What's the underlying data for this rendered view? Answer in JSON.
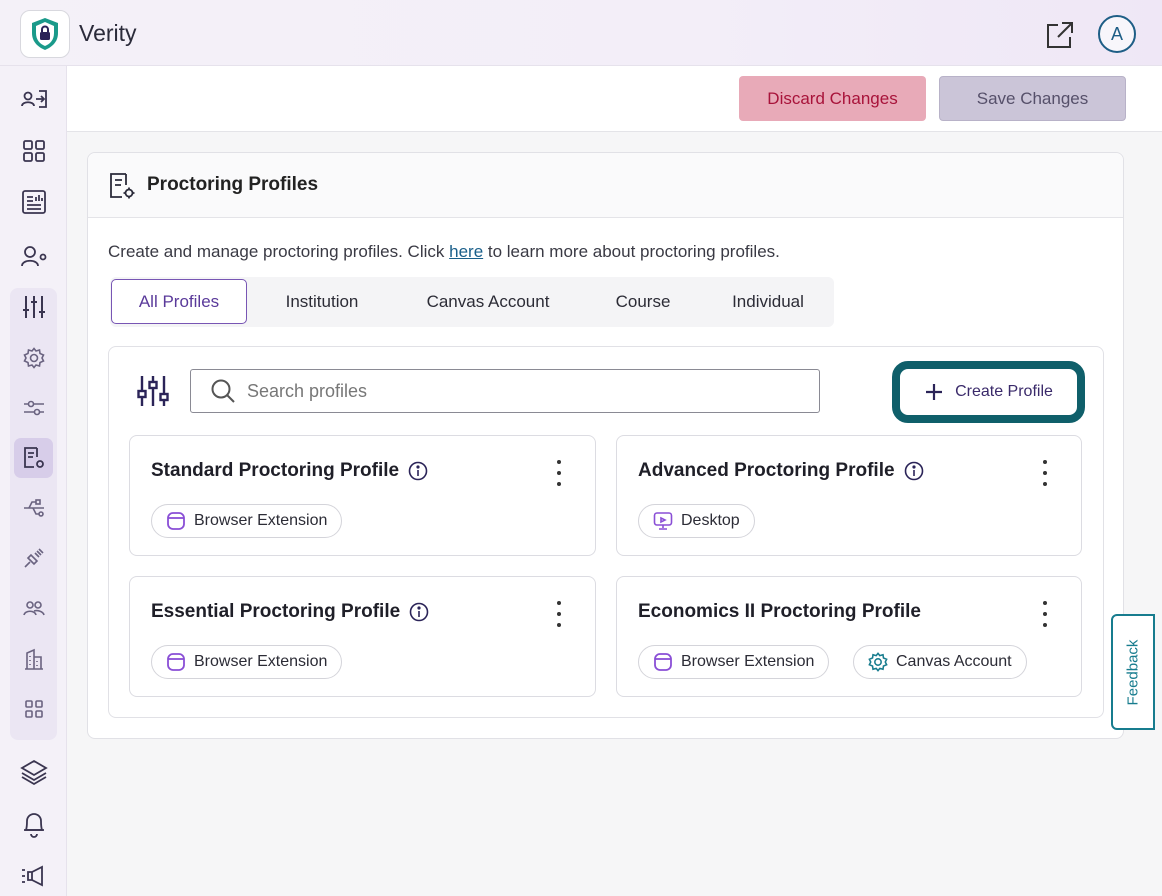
{
  "app": {
    "title": "Verity",
    "avatar_initial": "A"
  },
  "toolbar": {
    "discard_label": "Discard Changes",
    "save_label": "Save Changes"
  },
  "panel": {
    "title": "Proctoring Profiles",
    "description_before": "Create and manage proctoring profiles. Click ",
    "description_link": "here",
    "description_after": " to learn more about proctoring profiles."
  },
  "tabs": [
    {
      "label": "All Profiles",
      "active": true
    },
    {
      "label": "Institution",
      "active": false
    },
    {
      "label": "Canvas Account",
      "active": false
    },
    {
      "label": "Course",
      "active": false
    },
    {
      "label": "Individual",
      "active": false
    }
  ],
  "search": {
    "placeholder": "Search profiles",
    "value": ""
  },
  "create_button": {
    "label": "Create Profile"
  },
  "profiles": [
    {
      "name": "Standard Proctoring Profile",
      "has_info": true,
      "tags": [
        {
          "label": "Browser Extension",
          "icon": "browser-extension-icon"
        }
      ]
    },
    {
      "name": "Advanced Proctoring Profile",
      "has_info": true,
      "tags": [
        {
          "label": "Desktop",
          "icon": "desktop-icon"
        }
      ]
    },
    {
      "name": "Essential Proctoring Profile",
      "has_info": true,
      "tags": [
        {
          "label": "Browser Extension",
          "icon": "browser-extension-icon"
        }
      ]
    },
    {
      "name": "Economics II Proctoring Profile",
      "has_info": false,
      "tags": [
        {
          "label": "Browser Extension",
          "icon": "browser-extension-icon"
        },
        {
          "label": "Canvas Account",
          "icon": "gear-icon"
        }
      ]
    }
  ],
  "feedback": {
    "label": "Feedback"
  },
  "colors": {
    "accent": "#7856b4",
    "teal": "#0f5f6a",
    "discard_bg": "#e8aab8",
    "save_bg": "#cbc5d8"
  }
}
